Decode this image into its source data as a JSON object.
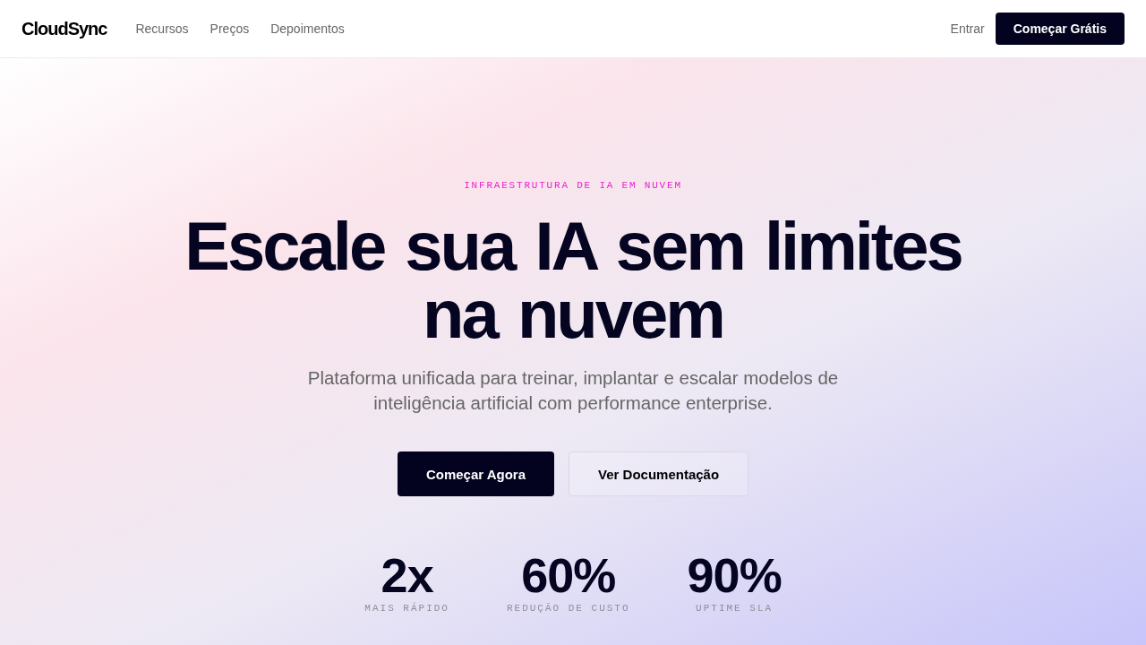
{
  "nav": {
    "logo": "CloudSync",
    "links": [
      "Recursos",
      "Preços",
      "Depoimentos"
    ],
    "login": "Entrar",
    "cta": "Começar Grátis"
  },
  "hero": {
    "eyebrow": "INFRAESTRUTURA DE IA EM NUVEM",
    "headline": "Escale sua IA sem limites na nuvem",
    "subtitle": "Plataforma unificada para treinar, implantar e escalar modelos de inteligência artificial com performance enterprise.",
    "buttons": [
      {
        "label": "Começar Agora",
        "kind": "primary"
      },
      {
        "label": "Ver Documentação",
        "kind": "secondary"
      }
    ],
    "stats": [
      {
        "value": "2x",
        "label": "MAIS RÁPIDO"
      },
      {
        "value": "60%",
        "label": "REDUÇÃO DE CUSTO"
      },
      {
        "value": "90%",
        "label": "UPTIME SLA"
      }
    ]
  }
}
